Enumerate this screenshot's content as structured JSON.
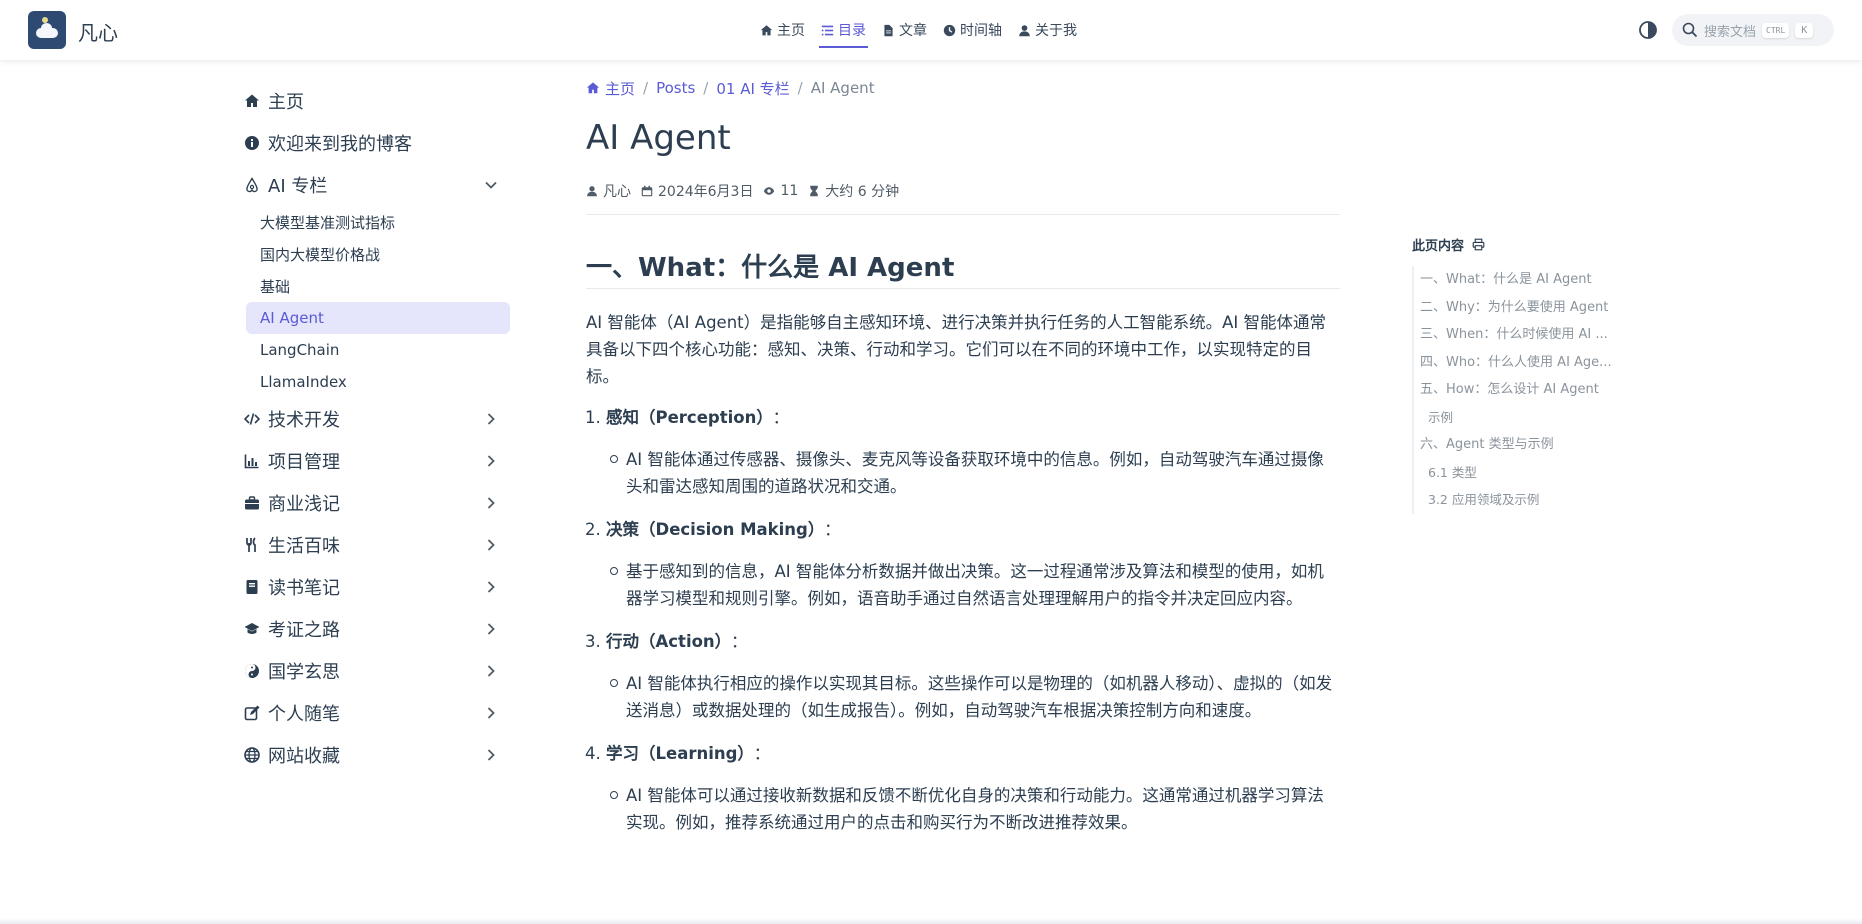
{
  "brand": {
    "name": "凡心"
  },
  "topnav": [
    {
      "label": "主页",
      "icon": "home-icon",
      "active": false
    },
    {
      "label": "目录",
      "icon": "list-icon",
      "active": true
    },
    {
      "label": "文章",
      "icon": "file-icon",
      "active": false
    },
    {
      "label": "时间轴",
      "icon": "clock-icon",
      "active": false
    },
    {
      "label": "关于我",
      "icon": "user-icon",
      "active": false
    }
  ],
  "search": {
    "placeholder": "搜索文档",
    "kbd_ctrl": "CTRL",
    "kbd_k": "K"
  },
  "sidebar": {
    "items": [
      {
        "label": "主页",
        "icon": "home-icon"
      },
      {
        "label": "欢迎来到我的博客",
        "icon": "info-icon"
      },
      {
        "label": "AI 专栏",
        "icon": "ai-icon",
        "expanded": true,
        "children": [
          "大模型基准测试指标",
          "国内大模型价格战",
          "基础",
          "AI Agent",
          "LangChain",
          "LlamaIndex"
        ],
        "active_child": "AI Agent"
      },
      {
        "label": "技术开发",
        "icon": "code-icon"
      },
      {
        "label": "项目管理",
        "icon": "chart-icon"
      },
      {
        "label": "商业浅记",
        "icon": "briefcase-icon"
      },
      {
        "label": "生活百味",
        "icon": "utensils-icon"
      },
      {
        "label": "读书笔记",
        "icon": "book-icon"
      },
      {
        "label": "考证之路",
        "icon": "graduation-cap-icon"
      },
      {
        "label": "国学玄思",
        "icon": "yin-yang-icon"
      },
      {
        "label": "个人随笔",
        "icon": "edit-icon"
      },
      {
        "label": "网站收藏",
        "icon": "globe-icon"
      }
    ]
  },
  "breadcrumb": [
    "主页",
    "Posts",
    "01 AI 专栏",
    "AI Agent"
  ],
  "article": {
    "title": "AI Agent",
    "meta": {
      "author": "凡心",
      "date": "2024年6月3日",
      "views": "11",
      "reading_time": "大约 6 分钟"
    },
    "h2": "一、What：什么是 AI Agent",
    "intro": "AI 智能体（AI Agent）是指能够自主感知环境、进行决策并执行任务的人工智能系统。AI 智能体通常具备以下四个核心功能：感知、决策、行动和学习。它们可以在不同的环境中工作，以实现特定的目标。",
    "points": [
      {
        "label": "感知（Perception）",
        "colon": "：",
        "detail": "AI 智能体通过传感器、摄像头、麦克风等设备获取环境中的信息。例如，自动驾驶汽车通过摄像头和雷达感知周围的道路状况和交通。"
      },
      {
        "label": "决策（Decision Making）",
        "colon": "：",
        "detail": "基于感知到的信息，AI 智能体分析数据并做出决策。这一过程通常涉及算法和模型的使用，如机器学习模型和规则引擎。例如，语音助手通过自然语言处理理解用户的指令并决定回应内容。"
      },
      {
        "label": "行动（Action）",
        "colon": "：",
        "detail": "AI 智能体执行相应的操作以实现其目标。这些操作可以是物理的（如机器人移动）、虚拟的（如发送消息）或数据处理的（如生成报告）。例如，自动驾驶汽车根据决策控制方向和速度。"
      },
      {
        "label": "学习（Learning）",
        "colon": "：",
        "detail": "AI 智能体可以通过接收新数据和反馈不断优化自身的决策和行动能力。这通常通过机器学习算法实现。例如，推荐系统通过用户的点击和购买行为不断改进推荐效果。"
      }
    ]
  },
  "toc": {
    "title": "此页内容",
    "items": [
      {
        "label": "一、What：什么是 AI Agent",
        "level": 1
      },
      {
        "label": "二、Why：为什么要使用 Agent",
        "level": 1
      },
      {
        "label": "三、When：什么时候使用 AI ...",
        "level": 1
      },
      {
        "label": "四、Who：什么人使用 AI Age...",
        "level": 1
      },
      {
        "label": "五、How：怎么设计 AI Agent",
        "level": 1
      },
      {
        "label": "示例",
        "level": 2
      },
      {
        "label": "六、Agent 类型与示例",
        "level": 1
      },
      {
        "label": "6.1 类型",
        "level": 2
      },
      {
        "label": "3.2 应用领域及示例",
        "level": 2
      }
    ]
  },
  "colors": {
    "accent": "#5b5bd6",
    "text": "#2c3e50",
    "muted": "#8a939c",
    "active_bg": "#e5e5fb"
  }
}
